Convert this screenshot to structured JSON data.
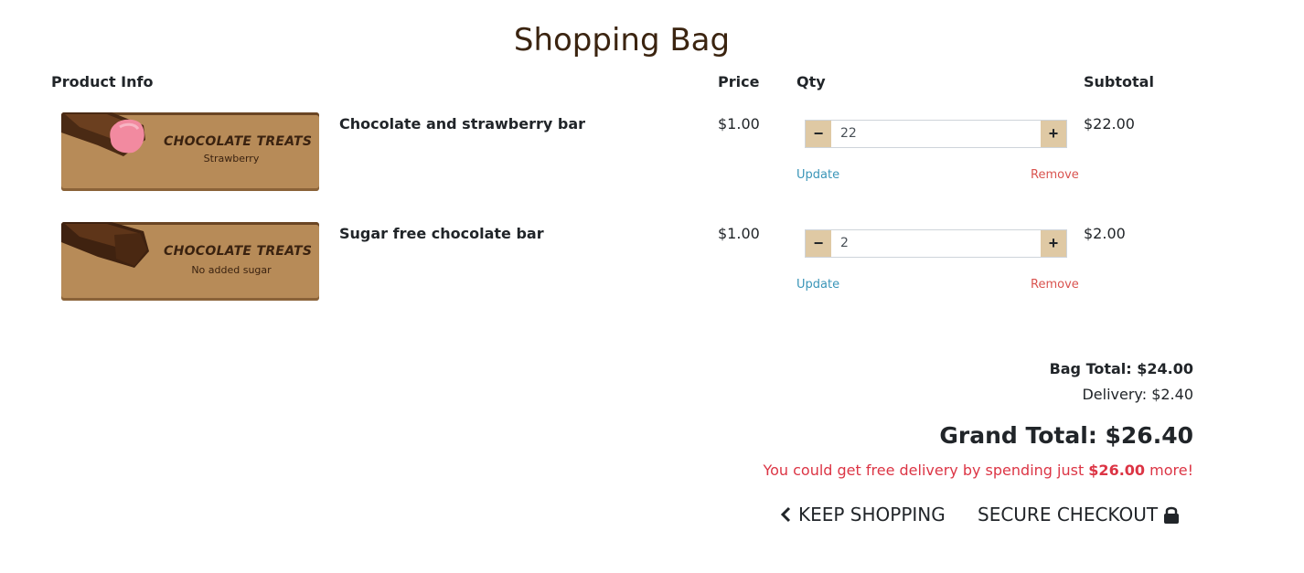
{
  "page": {
    "title": "Shopping Bag"
  },
  "columns": {
    "product": "Product Info",
    "price": "Price",
    "qty": "Qty",
    "subtotal": "Subtotal"
  },
  "items": [
    {
      "brand": "CHOCOLATE TREATS",
      "flavor": "Strawberry",
      "name": "Chocolate and strawberry bar",
      "price": "$1.00",
      "qty": "22",
      "subtotal": "$22.00",
      "update": "Update",
      "remove": "Remove"
    },
    {
      "brand": "CHOCOLATE TREATS",
      "flavor": "No added sugar",
      "name": "Sugar free chocolate bar",
      "price": "$1.00",
      "qty": "2",
      "subtotal": "$2.00",
      "update": "Update",
      "remove": "Remove"
    }
  ],
  "summary": {
    "bag_total": "Bag Total: $24.00",
    "delivery": "Delivery: $2.40",
    "grand_total": "Grand Total: $26.40",
    "free_prefix": "You could get free delivery by spending just ",
    "free_amount": "$26.00",
    "free_suffix": " more!"
  },
  "actions": {
    "keep_shopping": "KEEP SHOPPING",
    "checkout": "SECURE CHECKOUT"
  },
  "colors": {
    "accent": "#dfc9a4",
    "danger": "#dc3545",
    "link": "#3a95b8",
    "title": "#3b2410"
  }
}
